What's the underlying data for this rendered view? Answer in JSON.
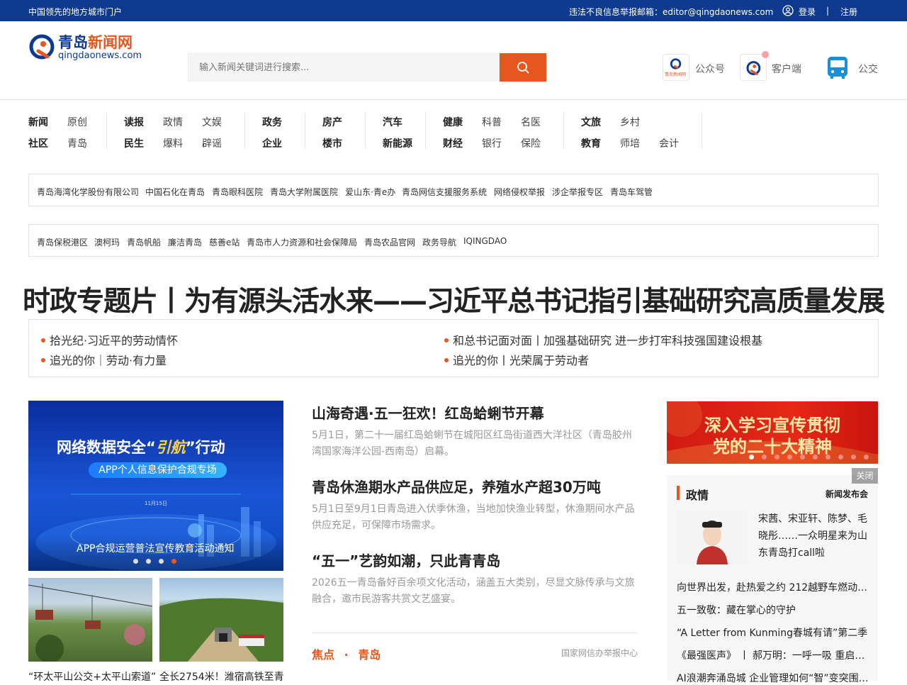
{
  "topbar": {
    "tagline": "中国领先的地方城市门户",
    "report": "违法不良信息举报邮箱：editor@qingdaonews.com",
    "login": "登录",
    "sep": "|",
    "register": "注册"
  },
  "logo": {
    "cn_main": "青岛",
    "cn_accent": "新闻网",
    "en": "qingdaonews.com"
  },
  "search": {
    "placeholder": "输入新闻关键词进行搜索..."
  },
  "quick": {
    "wechat": "公众号",
    "app": "客户端",
    "bus": "公交",
    "wechat_badge": "青岛新闻网"
  },
  "nav": {
    "g1": [
      "新闻",
      "原创",
      "社区",
      "青岛"
    ],
    "g2": [
      "读报",
      "政情",
      "文娱",
      "民生",
      "爆料",
      "辟谣"
    ],
    "g3": [
      "政务",
      "企业"
    ],
    "g4": [
      "房产",
      "楼市"
    ],
    "g5": [
      "汽车",
      "新能源"
    ],
    "g6": [
      "健康",
      "科普",
      "名医",
      "财经",
      "银行",
      "保险"
    ],
    "g7": [
      "文旅",
      "乡村",
      "教育",
      "师培",
      "会计"
    ]
  },
  "links1": [
    "青岛海湾化学股份有限公司",
    "中国石化在青岛",
    "青岛眼科医院",
    "青岛大学附属医院",
    "爱山东·青e办",
    "青岛网信支援服务系统",
    "网络侵权举报",
    "涉企举报专区",
    "青岛车驾管"
  ],
  "links2": [
    "青岛保税港区",
    "澳柯玛",
    "青岛帆船",
    "廉洁青岛",
    "慈善e站",
    "青岛市人力资源和社会保障局",
    "青岛农品官网",
    "政务导航",
    "IQINGDAO"
  ],
  "headline": "时政专题片丨为有源头活水来——习近平总书记指引基础研究高质量发展",
  "subs": [
    "拾光纪·习近平的劳动情怀",
    "追光的你｜劳动·有力量",
    "和总书记面对面丨加强基础研究 进一步打牢科技强国建设根基",
    "追光的你丨光荣属于劳动者"
  ],
  "carousel": {
    "line1": "网络数据安全“",
    "line1_script": "引航",
    "line1_end": "”行动",
    "line2": "APP个人信息保护合规专场",
    "date": "11月15日",
    "caption": "APP合规运营普法宣传教育活动通知",
    "active_index": 3
  },
  "thumbs": [
    "“环太平山公交+太平山索道”",
    "全长2754米！潍宿高铁至青"
  ],
  "articles": [
    {
      "title": "山海奇遇·五一狂欢！红岛蛤蜊节开幕",
      "summary": "5月1日，第二十一届红岛蛤蜊节在城阳区红岛街道西大洋社区（青岛胶州湾国家海洋公园-西南岛）启幕。"
    },
    {
      "title": "青岛休渔期水产品供应足，养殖水产超30万吨",
      "summary": "5月1日至9月1日青岛进入伏季休渔，当地加快渔业转型，休渔期间水产品供应充足，可保障市场需求。"
    },
    {
      "title": "“五一”艺韵如潮，只此青青岛",
      "summary": "2026五一青岛备好百余项文化活动，涵盖五大类别，尽显文脉传承与文旅融合，邀市民游客共赏文艺盛宴。"
    }
  ],
  "focus": {
    "tab1": "焦点",
    "dot": "·",
    "tab2": "青岛",
    "right": "国家网信办举报中心"
  },
  "banner": {
    "line1": "深入学习宣传贯彻",
    "line2": "党的二十大精神",
    "close": "关闭"
  },
  "panel": {
    "title": "政情",
    "more": "新闻发布会",
    "feature": "宋茜、宋亚轩、陈梦、毛晓彤……一众明星来为山东青岛打call啦",
    "items": [
      "向世界出发，赴热爱之约 212越野车燃动…",
      "五一致敬：藏在掌心的守护",
      "“A Letter from Kunming春城有请”第二季…",
      "《最强医声》 丨 郝万明：一呼一吸 重启…",
      "AI浪潮奔涌岛城 企业管理如何“智”变突围…"
    ]
  },
  "colors": {
    "brand_blue": "#0d3a8e",
    "accent_orange": "#e8561f",
    "banner_red": "#d21a12"
  }
}
